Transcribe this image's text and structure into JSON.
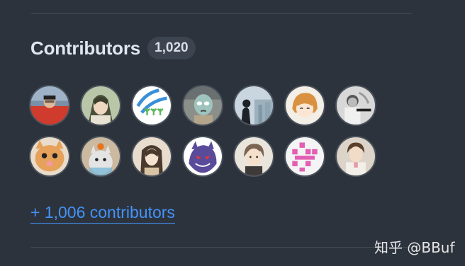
{
  "section": {
    "title": "Contributors",
    "count": "1,020",
    "more_link": "+ 1,006 contributors"
  },
  "avatars": [
    {
      "name": "avatar-1"
    },
    {
      "name": "avatar-2"
    },
    {
      "name": "avatar-3"
    },
    {
      "name": "avatar-4"
    },
    {
      "name": "avatar-5"
    },
    {
      "name": "avatar-6"
    },
    {
      "name": "avatar-7"
    },
    {
      "name": "avatar-8"
    },
    {
      "name": "avatar-9"
    },
    {
      "name": "avatar-10"
    },
    {
      "name": "avatar-11"
    },
    {
      "name": "avatar-12"
    },
    {
      "name": "avatar-13"
    },
    {
      "name": "avatar-14"
    }
  ],
  "watermark": "知乎 @BBuf",
  "colors": {
    "background": "#2c333d",
    "link": "#4493f8",
    "badge": "#3c444f"
  }
}
